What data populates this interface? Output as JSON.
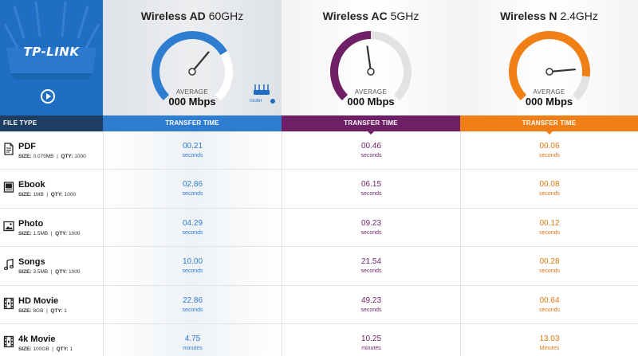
{
  "brand": {
    "logo_text": "TP-LINK"
  },
  "gauges": [
    {
      "id": "ad",
      "name": "Wireless AD",
      "band": "60GHz",
      "avg_label": "AVERAGE",
      "avg_value": "000 Mbps",
      "color": "#2f7dd1",
      "track": "#ffffff",
      "fill_fraction": 0.72,
      "needle_angle": 40
    },
    {
      "id": "ac",
      "name": "Wireless AC",
      "band": "5GHz",
      "avg_label": "AVERAGE",
      "avg_value": "000 Mbps",
      "color": "#6e1f66",
      "track": "#e2e2e2",
      "fill_fraction": 0.5,
      "needle_angle": -8
    },
    {
      "id": "n",
      "name": "Wireless N",
      "band": "2.4GHz",
      "avg_label": "AVERAGE",
      "avg_value": "000 Mbps",
      "color": "#f07f16",
      "track": "#e2e2e2",
      "fill_fraction": 0.86,
      "needle_angle": 85
    }
  ],
  "router_badge": {
    "label": "router"
  },
  "columns": {
    "file_type": "FILE TYPE",
    "transfer_time": "TRANSFER TIME"
  },
  "rows": [
    {
      "name": "PDF",
      "size_label": "SIZE:",
      "size": "0.075MB",
      "qty_label": "QTY:",
      "qty": "1000",
      "icon": "pdf-file-icon",
      "ad": {
        "value": "00.21",
        "unit": "seconds"
      },
      "ac": {
        "value": "00.46",
        "unit": "seconds"
      },
      "n": {
        "value": "00.06",
        "unit": "seconds"
      }
    },
    {
      "name": "Ebook",
      "size_label": "SIZE:",
      "size": "1MB",
      "qty_label": "QTY:",
      "qty": "1000",
      "icon": "ebook-icon",
      "ad": {
        "value": "02.86",
        "unit": "seconds"
      },
      "ac": {
        "value": "06.15",
        "unit": "seconds"
      },
      "n": {
        "value": "00.08",
        "unit": "seconds"
      }
    },
    {
      "name": "Photo",
      "size_label": "SIZE:",
      "size": "1.5MB",
      "qty_label": "QTY:",
      "qty": "1000",
      "icon": "photo-icon",
      "ad": {
        "value": "04.29",
        "unit": "seconds"
      },
      "ac": {
        "value": "09.23",
        "unit": "seconds"
      },
      "n": {
        "value": "00.12",
        "unit": "seconds"
      }
    },
    {
      "name": "Songs",
      "size_label": "SIZE:",
      "size": "3.5MB",
      "qty_label": "QTY:",
      "qty": "1000",
      "icon": "music-note-icon",
      "ad": {
        "value": "10.00",
        "unit": "seconds"
      },
      "ac": {
        "value": "21.54",
        "unit": "seconds"
      },
      "n": {
        "value": "00.28",
        "unit": "seconds"
      }
    },
    {
      "name": "HD Movie",
      "size_label": "SIZE:",
      "size": "8GB",
      "qty_label": "QTY:",
      "qty": "1",
      "icon": "film-icon",
      "ad": {
        "value": "22.86",
        "unit": "seconds"
      },
      "ac": {
        "value": "49.23",
        "unit": "seconds"
      },
      "n": {
        "value": "00.64",
        "unit": "seconds"
      }
    },
    {
      "name": "4k Movie",
      "size_label": "SIZE:",
      "size": "100GB",
      "qty_label": "QTY:",
      "qty": "1",
      "icon": "film-icon",
      "ad": {
        "value": "4.75",
        "unit": "minutes"
      },
      "ac": {
        "value": "10.25",
        "unit": "minutes"
      },
      "n": {
        "value": "13.03",
        "unit": "Minutes"
      }
    }
  ]
}
